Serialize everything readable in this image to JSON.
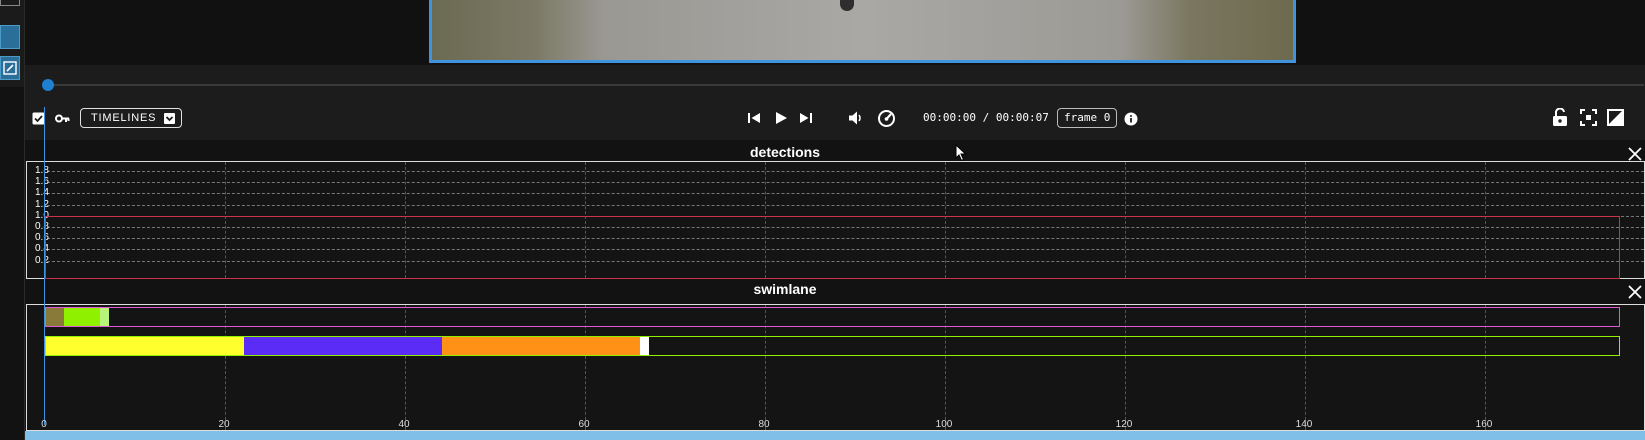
{
  "toolbar": {
    "timelines_label": "TIMELINES",
    "time_current": "00:00:00",
    "time_separator": "/",
    "time_total": "00:00:07",
    "frame_label": "frame 0"
  },
  "seek": {
    "progress": 0.0
  },
  "timelines": {
    "detections": {
      "title": "detections",
      "y_ticks": [
        "1.8",
        "1.6",
        "1.4",
        "1.2",
        "1.0",
        "0.8",
        "0.6",
        "0.4",
        "0.2"
      ],
      "box": {
        "start": 0,
        "end": 175,
        "value": 1.0,
        "color": "#d0314a"
      }
    },
    "swimlane": {
      "title": "swimlane",
      "lanes": [
        {
          "border": "#e058d6",
          "segments": [
            {
              "start": 0,
              "end": 2,
              "color": "#8a7a3a"
            },
            {
              "start": 2,
              "end": 6,
              "color": "#8ff000"
            },
            {
              "start": 6,
              "end": 7,
              "color": "#b8f47a"
            }
          ]
        },
        {
          "border": "#8ff000",
          "segments": [
            {
              "start": 0,
              "end": 22,
              "color": "#ffff2e"
            },
            {
              "start": 22,
              "end": 44,
              "color": "#5a2cf5"
            },
            {
              "start": 44,
              "end": 66,
              "color": "#ff9216"
            },
            {
              "start": 66,
              "end": 67,
              "color": "#ffffff"
            }
          ]
        }
      ]
    },
    "x_axis": {
      "min": 0,
      "max": 175,
      "ticks": [
        "0",
        "20",
        "40",
        "60",
        "80",
        "100",
        "120",
        "140",
        "160"
      ]
    }
  },
  "colors": {
    "accent": "#3f93df",
    "bottom_strip": "#7fbfe8"
  },
  "icons": [
    "checkbox-icon",
    "key-icon",
    "chevron-down-icon",
    "skip-previous-icon",
    "play-icon",
    "skip-next-icon",
    "volume-icon",
    "speed-icon",
    "info-icon",
    "lock-open-icon",
    "fullscreen-icon",
    "contrast-icon",
    "close-icon",
    "edit-icon"
  ]
}
